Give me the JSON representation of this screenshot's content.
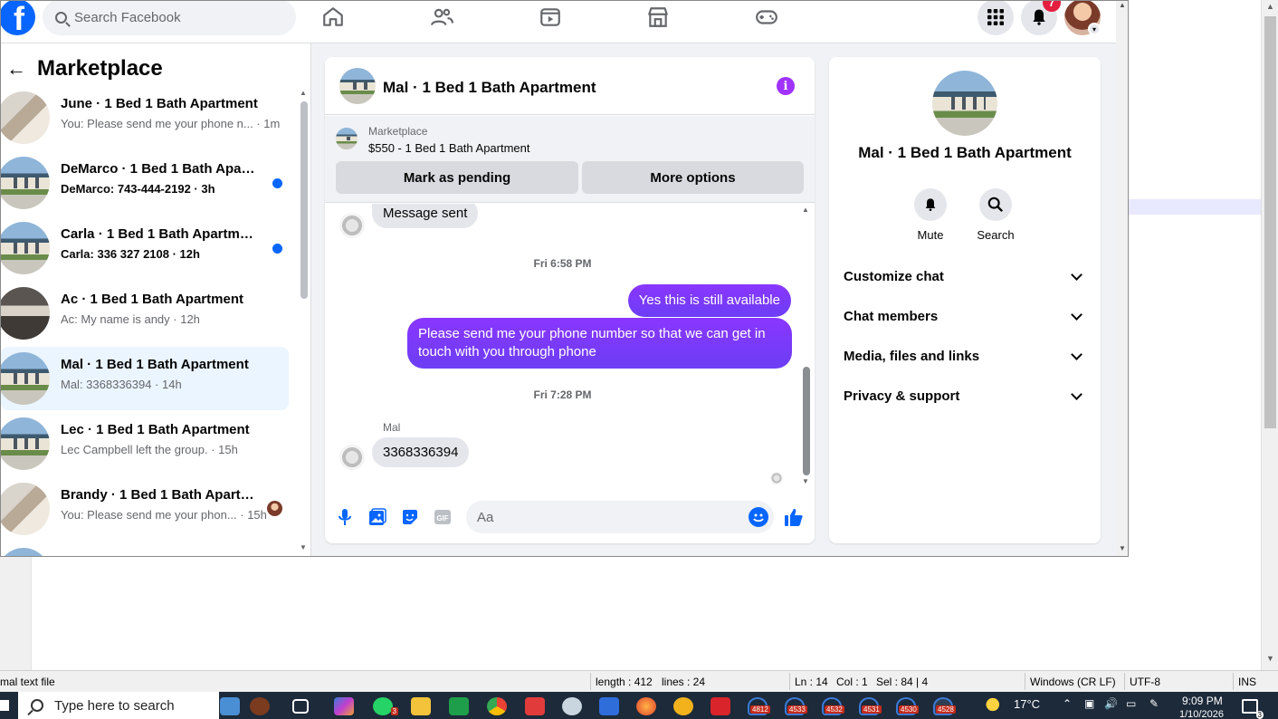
{
  "facebook": {
    "search_placeholder": "Search Facebook",
    "notification_count": "7"
  },
  "marketplace": {
    "back_label": "Marketplace",
    "conversations": [
      {
        "title": "June · 1 Bed 1 Bath Apartment",
        "preview": "You: Please send me your phone n... · 1m",
        "unread": false,
        "thumb": "room"
      },
      {
        "title": "DeMarco · 1 Bed 1 Bath Apart...",
        "preview": "DeMarco: 743-444-2192 · 3h",
        "unread": true,
        "thumb": "house"
      },
      {
        "title": "Carla · 1 Bed 1 Bath Apartment",
        "preview": "Carla: 336 327 2108 · 12h",
        "unread": true,
        "thumb": "house"
      },
      {
        "title": "Ac · 1 Bed 1 Bath Apartment",
        "preview": "Ac: My name is andy · 12h",
        "unread": false,
        "thumb": "kitchen"
      },
      {
        "title": "Mal · 1 Bed 1 Bath Apartment",
        "preview": "Mal: 3368336394 · 14h",
        "unread": false,
        "thumb": "house"
      },
      {
        "title": "Lec · 1 Bed 1 Bath Apartment",
        "preview": "Lec Campbell left the group. · 15h",
        "unread": false,
        "thumb": "house"
      },
      {
        "title": "Brandy · 1 Bed 1 Bath Apartm...",
        "preview": "You: Please send me your phon... · 15h",
        "unread": false,
        "thumb": "room"
      }
    ]
  },
  "chat": {
    "title": "Mal · 1 Bed 1 Bath Apartment",
    "listing_label": "Marketplace",
    "listing_price": "$550 - 1 Bed 1 Bath Apartment",
    "mark_pending": "Mark as pending",
    "more_options": "More options",
    "messages": {
      "msg1": "Message sent",
      "time1": "Fri 6:58 PM",
      "out1": "Yes this is still available",
      "out2": "Please send me your phone  number so that we can get in touch with you through phone",
      "time2": "Fri 7:28 PM",
      "sender": "Mal",
      "in2": "3368336394"
    },
    "input_placeholder": "Aa"
  },
  "info_panel": {
    "title": "Mal · 1 Bed 1 Bath Apartment",
    "mute": "Mute",
    "search": "Search",
    "rows": [
      "Customize chat",
      "Chat members",
      "Media, files and links",
      "Privacy & support"
    ]
  },
  "editor_status": {
    "file_type": "mal text file",
    "length": "length : 412",
    "lines": "lines : 24",
    "ln": "Ln : 14",
    "col": "Col : 1",
    "sel": "Sel : 84 | 4",
    "eol": "Windows (CR LF)",
    "encoding": "UTF-8",
    "mode": "INS"
  },
  "taskbar": {
    "search_placeholder": "Type here to search",
    "temperature": "17°C",
    "time": "9:09 PM",
    "date": "1/10/2026",
    "badges": [
      "3",
      "4812",
      "4533",
      "4532",
      "4531",
      "4530",
      "4528"
    ],
    "notification_count": "3"
  },
  "colors": {
    "fb_blue": "#0866ff",
    "messenger_purple": "#7b2ff7",
    "active_row": "#ebf5ff"
  }
}
